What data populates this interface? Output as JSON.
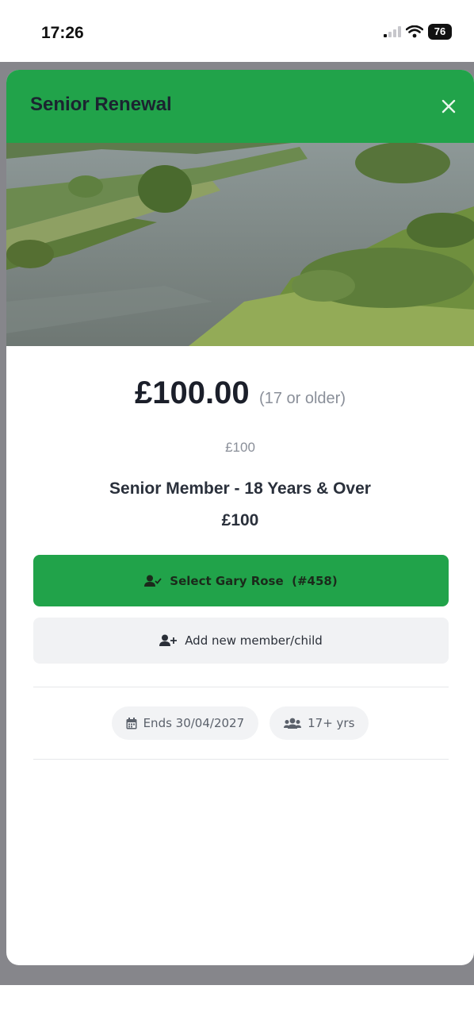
{
  "status_bar": {
    "time": "17:26",
    "battery": "76"
  },
  "modal": {
    "title": "Senior Renewal",
    "close_icon": "close-icon"
  },
  "price": {
    "amount": "£100.00",
    "note": "(17 or older)"
  },
  "sub_price": "£100",
  "membership": {
    "name": "Senior Member - 18 Years & Over",
    "price": "£100"
  },
  "actions": {
    "select_member": "Select Gary Rose  (#458)",
    "add_member": "Add new member/child"
  },
  "chips": {
    "ends": "Ends 30/04/2027",
    "age": "17+ yrs"
  },
  "colors": {
    "brand_green": "#21a34a",
    "backdrop": "#86868b"
  }
}
